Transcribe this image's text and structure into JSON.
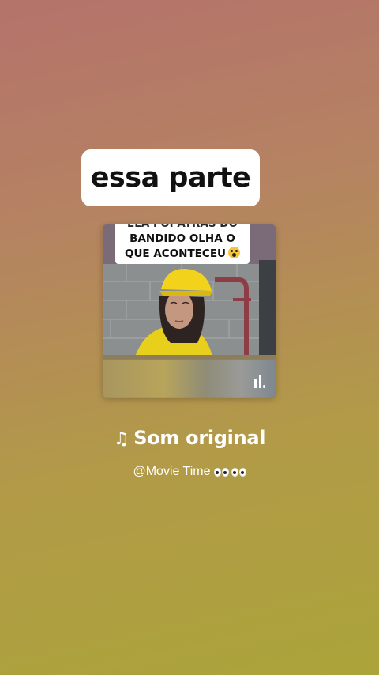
{
  "caption": {
    "text": "essa parte"
  },
  "video_thumbnail": {
    "overlay_lines": [
      "ELA FOI ATRÁS DO",
      "BANDIDO OLHA O",
      "QUE ACONTECEU"
    ],
    "overlay_emoji": "scream-emoji",
    "playing_indicator_icon": "audio-bars-icon"
  },
  "audio": {
    "note_icon": "♫",
    "title": "Som original",
    "author": "@Movie Time",
    "author_emoji": "eyes-emoji"
  },
  "colors": {
    "background_top": "#b5736b",
    "background_bottom": "#aba43a",
    "caption_bg": "#ffffff",
    "text": "#ffffff"
  }
}
